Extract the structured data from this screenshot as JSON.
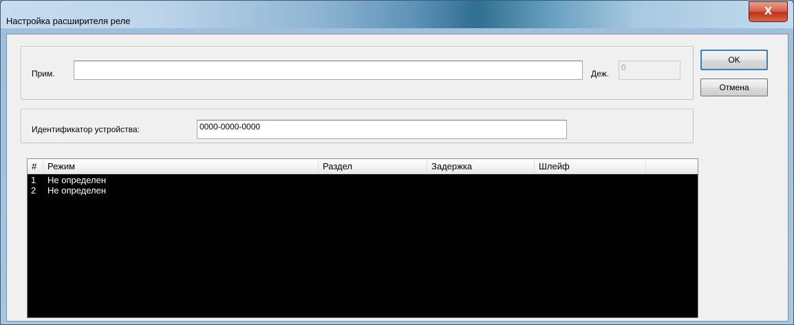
{
  "window": {
    "title": "Настройка расширителя реле",
    "close_glyph": "X"
  },
  "note": {
    "label": "Прим.",
    "value": ""
  },
  "duty": {
    "label": "Деж.",
    "value": "0"
  },
  "device_id": {
    "label": "Идентификатор устройства:",
    "value": "0000-0000-0000"
  },
  "buttons": {
    "ok": "OK",
    "cancel": "Отмена"
  },
  "table": {
    "columns": [
      "#",
      "Режим",
      "Раздел",
      "Задержка",
      "Шлейф"
    ],
    "rows": [
      {
        "num": "1",
        "mode": "Не определен",
        "section": "",
        "delay": "",
        "loop": ""
      },
      {
        "num": "2",
        "mode": "Не определен",
        "section": "",
        "delay": "",
        "loop": ""
      }
    ]
  }
}
